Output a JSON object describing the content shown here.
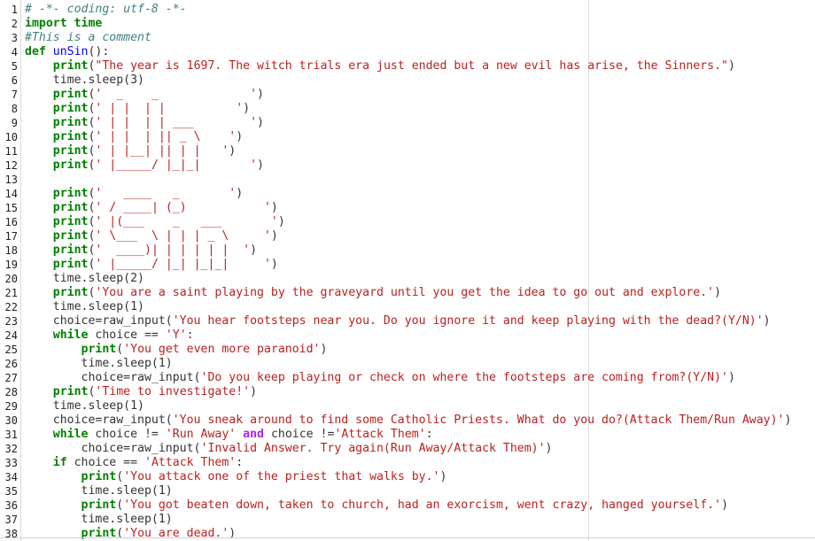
{
  "editor": {
    "language": "python",
    "lines": [
      {
        "n": "1",
        "parts": [
          {
            "t": "# -*- coding: utf-8 -*-",
            "c": "cm"
          }
        ]
      },
      {
        "n": "2",
        "parts": [
          {
            "t": "import",
            "c": "kw"
          },
          {
            "t": " time",
            "c": "kw"
          }
        ]
      },
      {
        "n": "3",
        "parts": [
          {
            "t": "#This is a comment",
            "c": "cm"
          }
        ]
      },
      {
        "n": "4",
        "parts": [
          {
            "t": "def",
            "c": "kw"
          },
          {
            "t": " "
          },
          {
            "t": "unSin",
            "c": "fn"
          },
          {
            "t": "():"
          }
        ]
      },
      {
        "n": "5",
        "parts": [
          {
            "t": "    "
          },
          {
            "t": "print",
            "c": "kw"
          },
          {
            "t": "("
          },
          {
            "t": "\"The year is 1697. The witch trials era just ended but a new evil has arise, the Sinners.\"",
            "c": "st"
          },
          {
            "t": ")"
          }
        ]
      },
      {
        "n": "6",
        "parts": [
          {
            "t": "    time.sleep(3)"
          }
        ]
      },
      {
        "n": "7",
        "parts": [
          {
            "t": "    "
          },
          {
            "t": "print",
            "c": "kw"
          },
          {
            "t": "("
          },
          {
            "t": "'  _    _             '",
            "c": "st"
          },
          {
            "t": ")"
          }
        ]
      },
      {
        "n": "8",
        "parts": [
          {
            "t": "    "
          },
          {
            "t": "print",
            "c": "kw"
          },
          {
            "t": "("
          },
          {
            "t": "' | |  | |          '",
            "c": "st"
          },
          {
            "t": ")"
          }
        ]
      },
      {
        "n": "9",
        "parts": [
          {
            "t": "    "
          },
          {
            "t": "print",
            "c": "kw"
          },
          {
            "t": "("
          },
          {
            "t": "' | |  | | ___        '",
            "c": "st"
          },
          {
            "t": ")"
          }
        ]
      },
      {
        "n": "10",
        "parts": [
          {
            "t": "    "
          },
          {
            "t": "print",
            "c": "kw"
          },
          {
            "t": "("
          },
          {
            "t": "' | |  | || _ \\    '",
            "c": "st"
          },
          {
            "t": ")"
          }
        ]
      },
      {
        "n": "11",
        "parts": [
          {
            "t": "    "
          },
          {
            "t": "print",
            "c": "kw"
          },
          {
            "t": "("
          },
          {
            "t": "' | |__| || | |   '",
            "c": "st"
          },
          {
            "t": ")"
          }
        ]
      },
      {
        "n": "12",
        "parts": [
          {
            "t": "    "
          },
          {
            "t": "print",
            "c": "kw"
          },
          {
            "t": "("
          },
          {
            "t": "' |_____/ |_|_|       '",
            "c": "st"
          },
          {
            "t": ")"
          }
        ]
      },
      {
        "n": "13",
        "parts": []
      },
      {
        "n": "14",
        "parts": [
          {
            "t": "    "
          },
          {
            "t": "print",
            "c": "kw"
          },
          {
            "t": "("
          },
          {
            "t": "'   ____   _       '",
            "c": "st"
          },
          {
            "t": ")"
          }
        ]
      },
      {
        "n": "15",
        "parts": [
          {
            "t": "    "
          },
          {
            "t": "print",
            "c": "kw"
          },
          {
            "t": "("
          },
          {
            "t": "' / ____| (_)           '",
            "c": "st"
          },
          {
            "t": ")"
          }
        ]
      },
      {
        "n": "16",
        "parts": [
          {
            "t": "    "
          },
          {
            "t": "print",
            "c": "kw"
          },
          {
            "t": "("
          },
          {
            "t": "' |(___    _   ___       '",
            "c": "st"
          },
          {
            "t": ")"
          }
        ]
      },
      {
        "n": "17",
        "parts": [
          {
            "t": "    "
          },
          {
            "t": "print",
            "c": "kw"
          },
          {
            "t": "("
          },
          {
            "t": "' \\___  \\ | | | _ \\     '",
            "c": "st"
          },
          {
            "t": ")"
          }
        ]
      },
      {
        "n": "18",
        "parts": [
          {
            "t": "    "
          },
          {
            "t": "print",
            "c": "kw"
          },
          {
            "t": "("
          },
          {
            "t": "'  ____)| | | | | |  '",
            "c": "st"
          },
          {
            "t": ")"
          }
        ]
      },
      {
        "n": "19",
        "parts": [
          {
            "t": "    "
          },
          {
            "t": "print",
            "c": "kw"
          },
          {
            "t": "("
          },
          {
            "t": "' |_____/ |_| |_|_|     '",
            "c": "st"
          },
          {
            "t": ")"
          }
        ]
      },
      {
        "n": "20",
        "parts": [
          {
            "t": "    time.sleep(2)"
          }
        ]
      },
      {
        "n": "21",
        "parts": [
          {
            "t": "    "
          },
          {
            "t": "print",
            "c": "kw"
          },
          {
            "t": "("
          },
          {
            "t": "'You are a saint playing by the graveyard until you get the idea to go out and explore.'",
            "c": "st"
          },
          {
            "t": ")"
          }
        ]
      },
      {
        "n": "22",
        "parts": [
          {
            "t": "    time.sleep(1)"
          }
        ]
      },
      {
        "n": "23",
        "parts": [
          {
            "t": "    choice=raw_input("
          },
          {
            "t": "'You hear footsteps near you. Do you ignore it and keep playing with the dead?(Y/N)'",
            "c": "st"
          },
          {
            "t": ")"
          }
        ]
      },
      {
        "n": "24",
        "parts": [
          {
            "t": "    "
          },
          {
            "t": "while",
            "c": "kw"
          },
          {
            "t": " choice == "
          },
          {
            "t": "'Y'",
            "c": "st"
          },
          {
            "t": ":"
          }
        ]
      },
      {
        "n": "25",
        "parts": [
          {
            "t": "        "
          },
          {
            "t": "print",
            "c": "kw"
          },
          {
            "t": "("
          },
          {
            "t": "'You get even more paranoid'",
            "c": "st"
          },
          {
            "t": ")"
          }
        ]
      },
      {
        "n": "26",
        "parts": [
          {
            "t": "        time.sleep(1)"
          }
        ]
      },
      {
        "n": "27",
        "parts": [
          {
            "t": "        choice=raw_input("
          },
          {
            "t": "'Do you keep playing or check on where the footsteps are coming from?(Y/N)'",
            "c": "st"
          },
          {
            "t": ")"
          }
        ]
      },
      {
        "n": "28",
        "parts": [
          {
            "t": "    "
          },
          {
            "t": "print",
            "c": "kw"
          },
          {
            "t": "("
          },
          {
            "t": "'Time to investigate!'",
            "c": "st"
          },
          {
            "t": ")"
          }
        ]
      },
      {
        "n": "29",
        "parts": [
          {
            "t": "    time.sleep(1)"
          }
        ]
      },
      {
        "n": "30",
        "parts": [
          {
            "t": "    choice=raw_input("
          },
          {
            "t": "'You sneak around to find some Catholic Priests. What do you do?(Attack Them/Run Away)'",
            "c": "st"
          },
          {
            "t": ")"
          }
        ]
      },
      {
        "n": "31",
        "parts": [
          {
            "t": "    "
          },
          {
            "t": "while",
            "c": "kw"
          },
          {
            "t": " choice != "
          },
          {
            "t": "'Run Away'",
            "c": "st"
          },
          {
            "t": " "
          },
          {
            "t": "and",
            "c": "op"
          },
          {
            "t": " choice !="
          },
          {
            "t": "'Attack Them'",
            "c": "st"
          },
          {
            "t": ":"
          }
        ]
      },
      {
        "n": "32",
        "parts": [
          {
            "t": "        choice=raw_input("
          },
          {
            "t": "'Invalid Answer. Try again(Run Away/Attack Them)'",
            "c": "st"
          },
          {
            "t": ")"
          }
        ]
      },
      {
        "n": "33",
        "parts": [
          {
            "t": "    "
          },
          {
            "t": "if",
            "c": "kw"
          },
          {
            "t": " choice == "
          },
          {
            "t": "'Attack Them'",
            "c": "st"
          },
          {
            "t": ":"
          }
        ]
      },
      {
        "n": "34",
        "parts": [
          {
            "t": "        "
          },
          {
            "t": "print",
            "c": "kw"
          },
          {
            "t": "("
          },
          {
            "t": "'You attack one of the priest that walks by.'",
            "c": "st"
          },
          {
            "t": ")"
          }
        ]
      },
      {
        "n": "35",
        "parts": [
          {
            "t": "        time.sleep(1)"
          }
        ]
      },
      {
        "n": "36",
        "parts": [
          {
            "t": "        "
          },
          {
            "t": "print",
            "c": "kw"
          },
          {
            "t": "("
          },
          {
            "t": "'You got beaten down, taken to church, had an exorcism, went crazy, hanged yourself.'",
            "c": "st"
          },
          {
            "t": ")"
          }
        ]
      },
      {
        "n": "37",
        "parts": [
          {
            "t": "        time.sleep(1)"
          }
        ]
      },
      {
        "n": "38",
        "parts": [
          {
            "t": "        "
          },
          {
            "t": "print",
            "c": "kw"
          },
          {
            "t": "("
          },
          {
            "t": "'You are dead.'",
            "c": "st"
          },
          {
            "t": ")"
          }
        ]
      }
    ]
  }
}
